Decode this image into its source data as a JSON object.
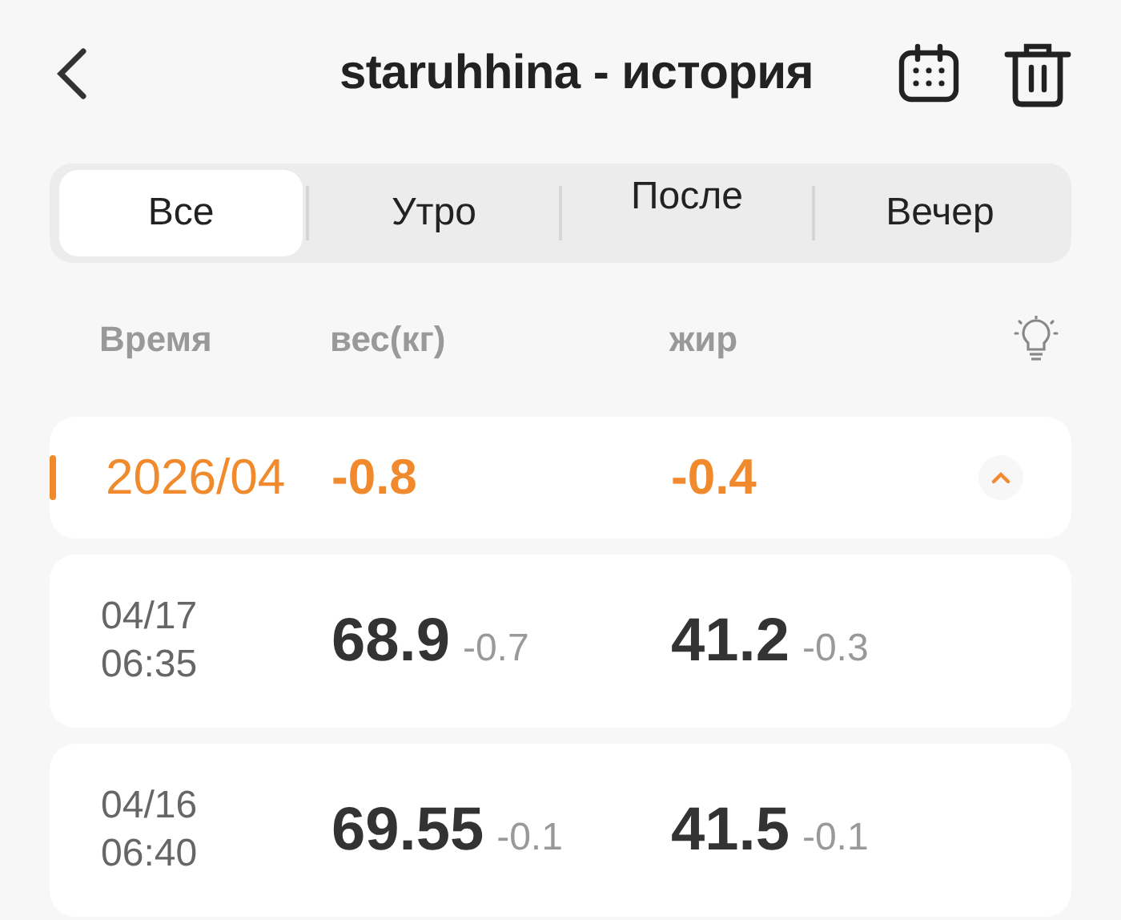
{
  "header": {
    "title": "staruhhina - история"
  },
  "tabs": [
    {
      "label": "Все",
      "selected": true
    },
    {
      "label": "Утро",
      "selected": false
    },
    {
      "label": "После",
      "selected": false
    },
    {
      "label": "Вечер",
      "selected": false
    }
  ],
  "columns": [
    "Время",
    "вес(кг)",
    "жир"
  ],
  "month": {
    "label": "2026/04",
    "weight_change": "-0.8",
    "fat_change": "-0.4",
    "expanded": true
  },
  "records": [
    {
      "date": "04/17",
      "time": "06:35",
      "weight": "68.9",
      "weight_change": "-0.7",
      "fat": "41.2",
      "fat_change": "-0.3"
    },
    {
      "date": "04/16",
      "time": "06:40",
      "weight": "69.55",
      "weight_change": "-0.1",
      "fat": "41.5",
      "fat_change": "-0.1"
    }
  ]
}
